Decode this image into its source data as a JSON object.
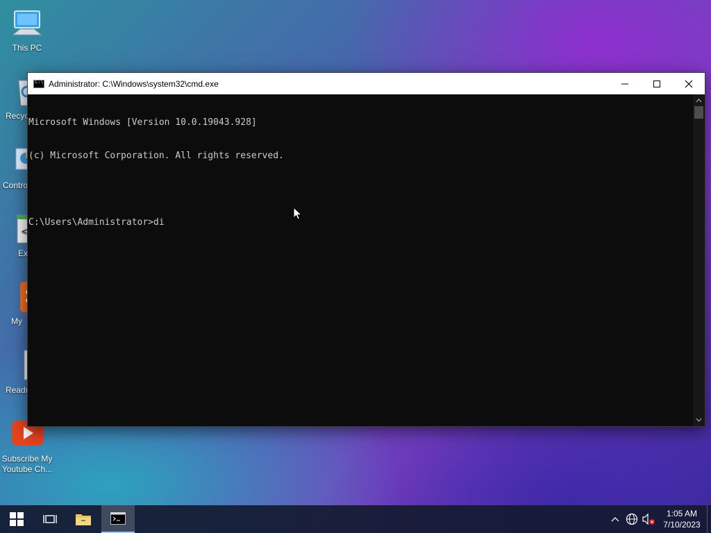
{
  "desktop": {
    "icons": [
      {
        "label": "This PC",
        "icon": "this-pc-icon"
      },
      {
        "label": "Recyc",
        "icon": "recycle-bin-icon"
      },
      {
        "label": "Contro",
        "icon": "control-panel-icon"
      },
      {
        "label": "Ex",
        "icon": "script-file-icon"
      },
      {
        "label": "My",
        "icon": "blogger-icon"
      },
      {
        "label": "Readm",
        "icon": "text-file-icon"
      },
      {
        "label": "Subscribe My Youtube Ch...",
        "icon": "youtube-icon"
      }
    ]
  },
  "window": {
    "title": "Administrator: C:\\Windows\\system32\\cmd.exe",
    "console_lines": [
      "Microsoft Windows [Version 10.0.19043.928]",
      "(c) Microsoft Corporation. All rights reserved.",
      "",
      "C:\\Users\\Administrator>di"
    ]
  },
  "taskbar": {
    "buttons": [
      "start-icon",
      "task-view-icon",
      "file-explorer-icon",
      "cmd-icon"
    ],
    "tray_icons": [
      "chevron-up-icon",
      "network-globe-icon",
      "speaker-muted-icon"
    ],
    "time": "1:05 AM",
    "date": "7/10/2023"
  },
  "colors": {
    "console_bg": "#0c0c0c",
    "console_text": "#cccccc",
    "titlebar_bg": "#ffffff",
    "taskbar_bg": "#141a30"
  }
}
